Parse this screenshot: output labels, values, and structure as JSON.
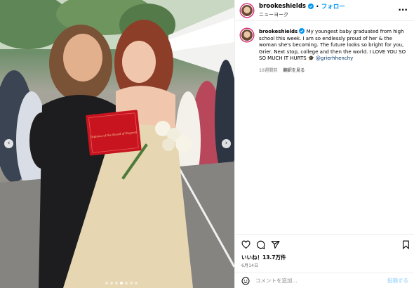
{
  "post": {
    "username": "brookeshields",
    "follow_label": "フォロー",
    "separator": "•",
    "location": "ニューヨーク",
    "caption_text": "My youngest baby graduated from high school this week. I am so endlessly proud of her & the woman she's becoming. The future looks so bright for you, Grier. Next stop, college and then the world. I LOVE YOU SO SO MUCH IT HURTS 🎓",
    "mention": "@grierhhenchy",
    "time_ago": "10週間前",
    "translate_label": "翻訳を見る",
    "likes": "いいね！13.7万件",
    "date": "6月14日",
    "comment_placeholder": "コメントを追加...",
    "post_label": "投稿する",
    "diploma_text": "Diploma of the Board of Regents"
  },
  "carousel": {
    "total": 7,
    "active_index": 3
  },
  "colors": {
    "accent": "#0095f6",
    "verified": "#0095f6",
    "diploma": "#c8141e",
    "post_disabled": "#b2dffc"
  },
  "icons": [
    "verified-badge-icon",
    "more-options-icon",
    "heart-icon",
    "comment-icon",
    "share-icon",
    "bookmark-icon",
    "emoji-icon",
    "chevron-left-icon",
    "chevron-right-icon"
  ]
}
